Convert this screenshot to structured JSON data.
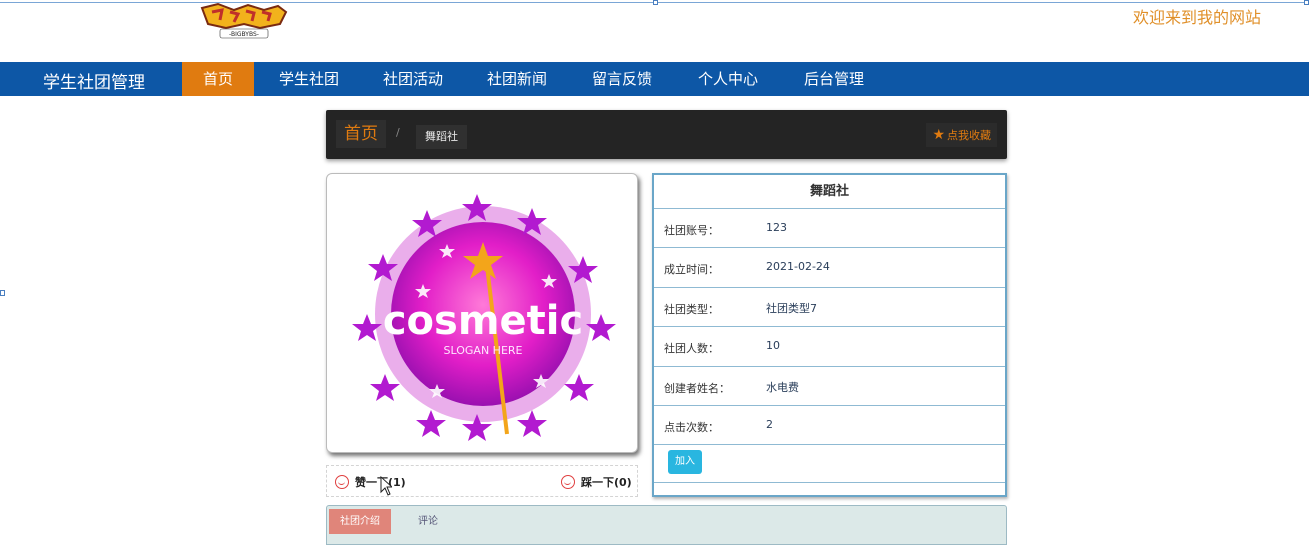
{
  "header": {
    "welcome": "欢迎来到我的网站",
    "logo_text": "-BIGBYBS-"
  },
  "nav": {
    "brand": "学生社团管理",
    "items": [
      {
        "label": "首页",
        "active": true
      },
      {
        "label": "学生社团",
        "active": false
      },
      {
        "label": "社团活动",
        "active": false
      },
      {
        "label": "社团新闻",
        "active": false
      },
      {
        "label": "留言反馈",
        "active": false
      },
      {
        "label": "个人中心",
        "active": false
      },
      {
        "label": "后台管理",
        "active": false
      }
    ]
  },
  "breadcrumb": {
    "home": "首页",
    "separator": "/",
    "current": "舞蹈社",
    "favorite": "点我收藏"
  },
  "club_image": {
    "word": "cosmetic",
    "slogan": "SLOGAN HERE"
  },
  "votes": {
    "like": "赞一下(1)",
    "dislike": "踩一下(0)"
  },
  "info": {
    "title": "舞蹈社",
    "rows": [
      {
        "key": "社团账号：",
        "value": "123"
      },
      {
        "key": "成立时间：",
        "value": "2021-02-24"
      },
      {
        "key": "社团类型：",
        "value": "社团类型7"
      },
      {
        "key": "社团人数：",
        "value": "10"
      },
      {
        "key": "创建者姓名：",
        "value": "水电费"
      },
      {
        "key": "点击次数：",
        "value": "2"
      }
    ],
    "join": "加入"
  },
  "tabs": [
    {
      "label": "社团介绍"
    },
    {
      "label": "评论"
    }
  ],
  "colors": {
    "nav_bg": "#0d57a6",
    "accent_orange": "#e07b10",
    "join_blue": "#29b6e0"
  }
}
